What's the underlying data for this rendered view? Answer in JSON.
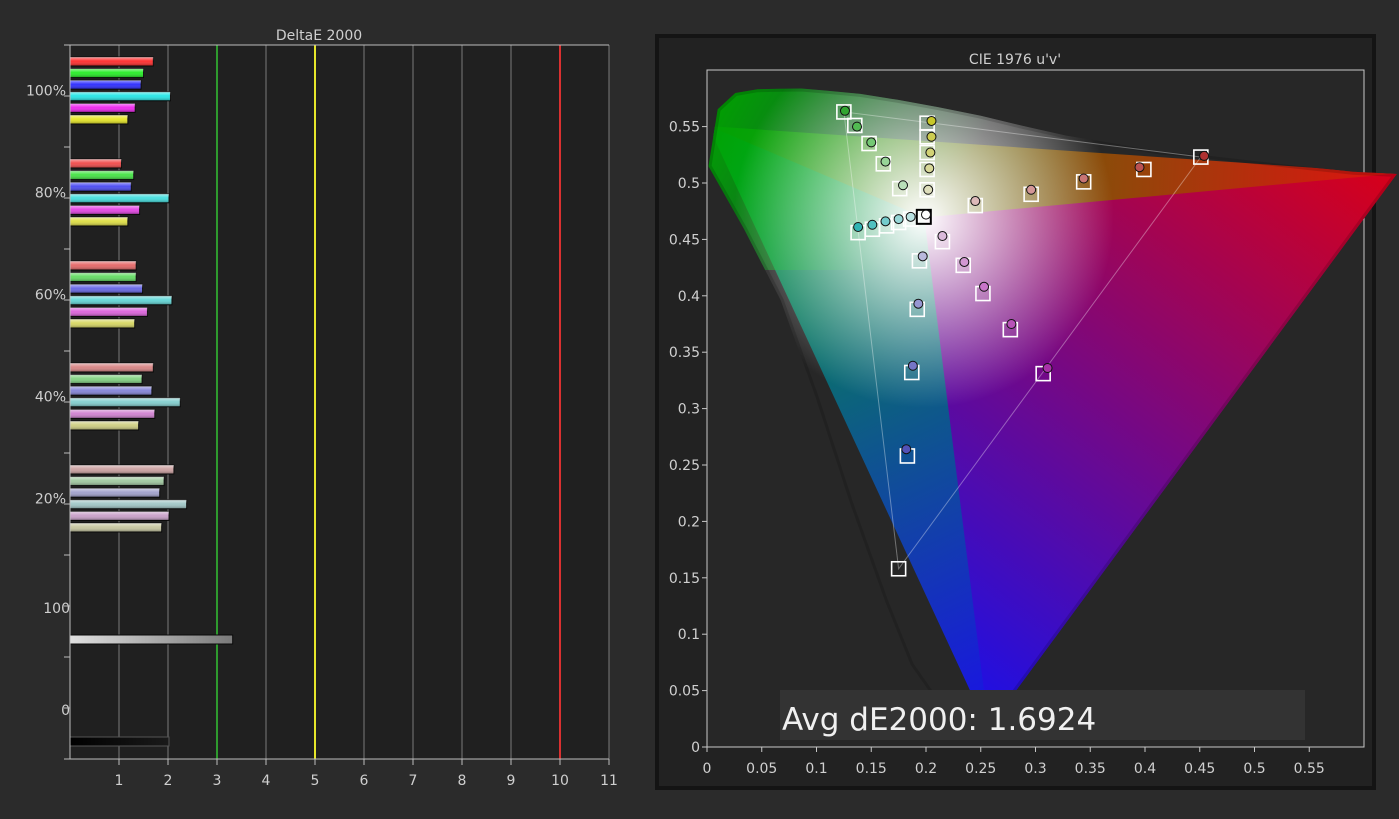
{
  "chart_data": [
    {
      "type": "bar",
      "orientation": "horizontal",
      "title": "DeltaE 2000",
      "xlim": [
        0,
        11
      ],
      "x_ticks": [
        "1",
        "2",
        "3",
        "4",
        "5",
        "6",
        "7",
        "8",
        "9",
        "10",
        "11"
      ],
      "y_tick_labels": [
        "100%",
        "80%",
        "60%",
        "40%",
        "20%",
        "100",
        "0"
      ],
      "threshold_lines": [
        {
          "value": 3,
          "color": "#2e9a2e"
        },
        {
          "value": 5,
          "color": "#e6e62a"
        },
        {
          "value": 10,
          "color": "#d93030"
        }
      ],
      "grid": "vertical",
      "series": [
        {
          "color": "#ff2a2a"
        },
        {
          "color": "#22ee22"
        },
        {
          "color": "#2a2aff"
        },
        {
          "color": "#22e6e6"
        },
        {
          "color": "#ee22ee"
        },
        {
          "color": "#e6e622"
        }
      ],
      "groups": [
        {
          "label": "100%",
          "saturation": 1.0,
          "values": [
            1.7,
            1.5,
            1.45,
            2.05,
            1.33,
            1.18
          ]
        },
        {
          "label": "80%",
          "saturation": 0.8,
          "values": [
            1.05,
            1.3,
            1.25,
            2.02,
            1.42,
            1.18
          ]
        },
        {
          "label": "60%",
          "saturation": 0.6,
          "values": [
            1.35,
            1.35,
            1.48,
            2.08,
            1.58,
            1.32
          ]
        },
        {
          "label": "40%",
          "saturation": 0.4,
          "values": [
            1.7,
            1.47,
            1.67,
            2.25,
            1.73,
            1.4
          ]
        },
        {
          "label": "20%",
          "saturation": 0.2,
          "values": [
            2.12,
            1.92,
            1.83,
            2.38,
            2.02,
            1.87
          ]
        }
      ],
      "white_value": 3.32,
      "black_value": 2.02
    },
    {
      "type": "scatter",
      "title": "CIE 1976 u'v'",
      "xlim": [
        0,
        0.6
      ],
      "ylim": [
        0,
        0.6
      ],
      "x_ticks": [
        "0",
        "0.05",
        "0.1",
        "0.15",
        "0.2",
        "0.25",
        "0.3",
        "0.35",
        "0.4",
        "0.45",
        "0.5",
        "0.55"
      ],
      "y_ticks": [
        "0",
        "0.05",
        "0.1",
        "0.15",
        "0.2",
        "0.25",
        "0.3",
        "0.35",
        "0.4",
        "0.45",
        "0.5",
        "0.55"
      ],
      "gamut_triangle": {
        "red": [
          0.451,
          0.523
        ],
        "green": [
          0.125,
          0.563
        ],
        "blue": [
          0.175,
          0.158
        ]
      },
      "targets": [
        [
          0.125,
          0.563
        ],
        [
          0.135,
          0.551
        ],
        [
          0.148,
          0.535
        ],
        [
          0.161,
          0.517
        ],
        [
          0.176,
          0.495
        ],
        [
          0.201,
          0.553
        ],
        [
          0.201,
          0.541
        ],
        [
          0.201,
          0.527
        ],
        [
          0.201,
          0.512
        ],
        [
          0.201,
          0.494
        ],
        [
          0.138,
          0.456
        ],
        [
          0.151,
          0.459
        ],
        [
          0.164,
          0.462
        ],
        [
          0.175,
          0.465
        ],
        [
          0.186,
          0.468
        ],
        [
          0.215,
          0.448
        ],
        [
          0.234,
          0.427
        ],
        [
          0.252,
          0.402
        ],
        [
          0.277,
          0.37
        ],
        [
          0.307,
          0.331
        ],
        [
          0.194,
          0.431
        ],
        [
          0.192,
          0.388
        ],
        [
          0.187,
          0.332
        ],
        [
          0.183,
          0.258
        ],
        [
          0.175,
          0.158
        ],
        [
          0.245,
          0.48
        ],
        [
          0.296,
          0.49
        ],
        [
          0.344,
          0.501
        ],
        [
          0.399,
          0.512
        ],
        [
          0.451,
          0.523
        ],
        [
          0.198,
          0.47
        ]
      ],
      "measured": [
        {
          "u": 0.126,
          "v": 0.564,
          "color": "#31a531"
        },
        {
          "u": 0.137,
          "v": 0.55,
          "color": "#52ba52"
        },
        {
          "u": 0.15,
          "v": 0.536,
          "color": "#74c874"
        },
        {
          "u": 0.163,
          "v": 0.519,
          "color": "#97d497"
        },
        {
          "u": 0.179,
          "v": 0.498,
          "color": "#b9dfb9"
        },
        {
          "u": 0.205,
          "v": 0.555,
          "color": "#c8c82a"
        },
        {
          "u": 0.205,
          "v": 0.541,
          "color": "#cccc50"
        },
        {
          "u": 0.204,
          "v": 0.527,
          "color": "#d2d275"
        },
        {
          "u": 0.203,
          "v": 0.513,
          "color": "#d8d898"
        },
        {
          "u": 0.202,
          "v": 0.494,
          "color": "#dedebb"
        },
        {
          "u": 0.138,
          "v": 0.461,
          "color": "#31b4b4"
        },
        {
          "u": 0.151,
          "v": 0.463,
          "color": "#52c0c0"
        },
        {
          "u": 0.163,
          "v": 0.466,
          "color": "#74cccc"
        },
        {
          "u": 0.175,
          "v": 0.468,
          "color": "#97d8d8"
        },
        {
          "u": 0.186,
          "v": 0.47,
          "color": "#b9e2e2"
        },
        {
          "u": 0.215,
          "v": 0.453,
          "color": "#dab9da"
        },
        {
          "u": 0.235,
          "v": 0.43,
          "color": "#d297d2"
        },
        {
          "u": 0.253,
          "v": 0.408,
          "color": "#c875c8"
        },
        {
          "u": 0.278,
          "v": 0.375,
          "color": "#b852b8"
        },
        {
          "u": 0.311,
          "v": 0.336,
          "color": "#a831a8"
        },
        {
          "u": 0.197,
          "v": 0.435,
          "color": "#b9b9dc"
        },
        {
          "u": 0.193,
          "v": 0.393,
          "color": "#9797d2"
        },
        {
          "u": 0.188,
          "v": 0.338,
          "color": "#7575c6"
        },
        {
          "u": 0.182,
          "v": 0.264,
          "color": "#5252b8"
        },
        {
          "u": 0.245,
          "v": 0.484,
          "color": "#dcb9b9"
        },
        {
          "u": 0.296,
          "v": 0.494,
          "color": "#d49797"
        },
        {
          "u": 0.344,
          "v": 0.504,
          "color": "#c87575"
        },
        {
          "u": 0.395,
          "v": 0.514,
          "color": "#bb5252"
        },
        {
          "u": 0.454,
          "v": 0.524,
          "color": "#ad3131"
        },
        {
          "u": 0.2,
          "v": 0.472,
          "color": "#ffffff"
        }
      ],
      "annotation": "Avg dE2000: 1.6924"
    }
  ]
}
